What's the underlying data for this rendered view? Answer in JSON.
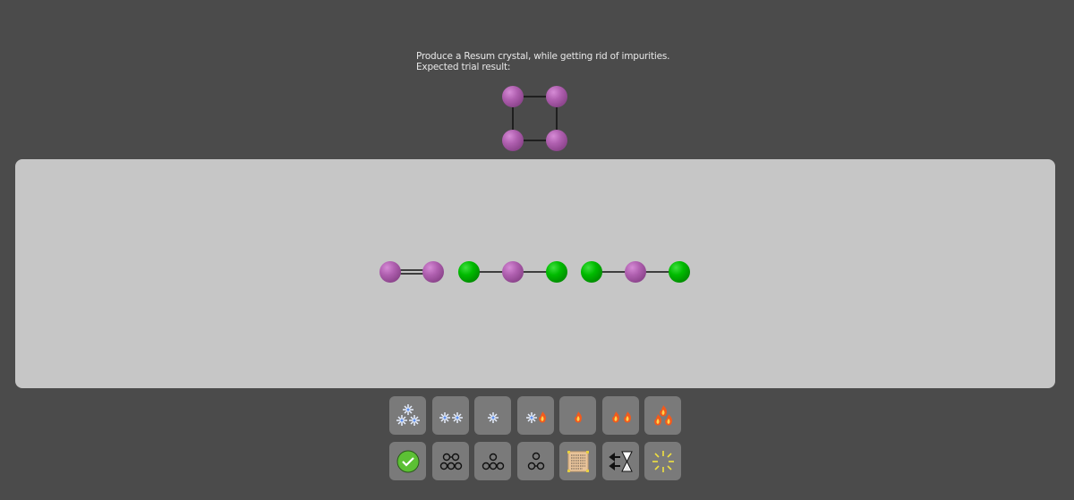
{
  "instructions": {
    "line1": "Produce a Resum crystal, while getting rid of impurities.",
    "line2": "Expected trial result:"
  },
  "colors": {
    "background": "#4b4b4b",
    "board": "#c6c6c6",
    "atom_purple": "#b060b0",
    "atom_green": "#00bb00",
    "tool_bg": "#7a7a7a"
  },
  "expected_result": {
    "atoms": [
      "purple",
      "purple",
      "purple",
      "purple"
    ],
    "shape": "square",
    "bonds": [
      "single",
      "single",
      "single",
      "single"
    ]
  },
  "board": {
    "molecules": [
      {
        "atoms": [
          "purple",
          "purple"
        ],
        "bonds": [
          "double"
        ]
      },
      {
        "atoms": [
          "green",
          "purple",
          "green"
        ],
        "bonds": [
          "single",
          "single"
        ]
      },
      {
        "atoms": [
          "green",
          "purple",
          "green"
        ],
        "bonds": [
          "single",
          "single"
        ]
      }
    ]
  },
  "toolbar": {
    "row1": [
      {
        "name": "freeze-triple-icon",
        "label": "Freeze three"
      },
      {
        "name": "freeze-double-icon",
        "label": "Freeze two"
      },
      {
        "name": "freeze-single-icon",
        "label": "Freeze one"
      },
      {
        "name": "freeze-heat-icon",
        "label": "Freeze and heat"
      },
      {
        "name": "heat-single-icon",
        "label": "Heat one"
      },
      {
        "name": "heat-double-icon",
        "label": "Heat two"
      },
      {
        "name": "heat-triple-icon",
        "label": "Heat three"
      }
    ],
    "row2": [
      {
        "name": "confirm-check-icon",
        "label": "Confirm"
      },
      {
        "name": "split-two-three-icon",
        "label": "Split 2/3"
      },
      {
        "name": "split-one-three-icon",
        "label": "Split 1/3"
      },
      {
        "name": "split-one-two-icon",
        "label": "Split 1/2"
      },
      {
        "name": "scroll-notes-icon",
        "label": "Notes"
      },
      {
        "name": "rewind-hourglass-icon",
        "label": "Rewind time"
      },
      {
        "name": "burst-icon",
        "label": "Burst"
      }
    ]
  }
}
